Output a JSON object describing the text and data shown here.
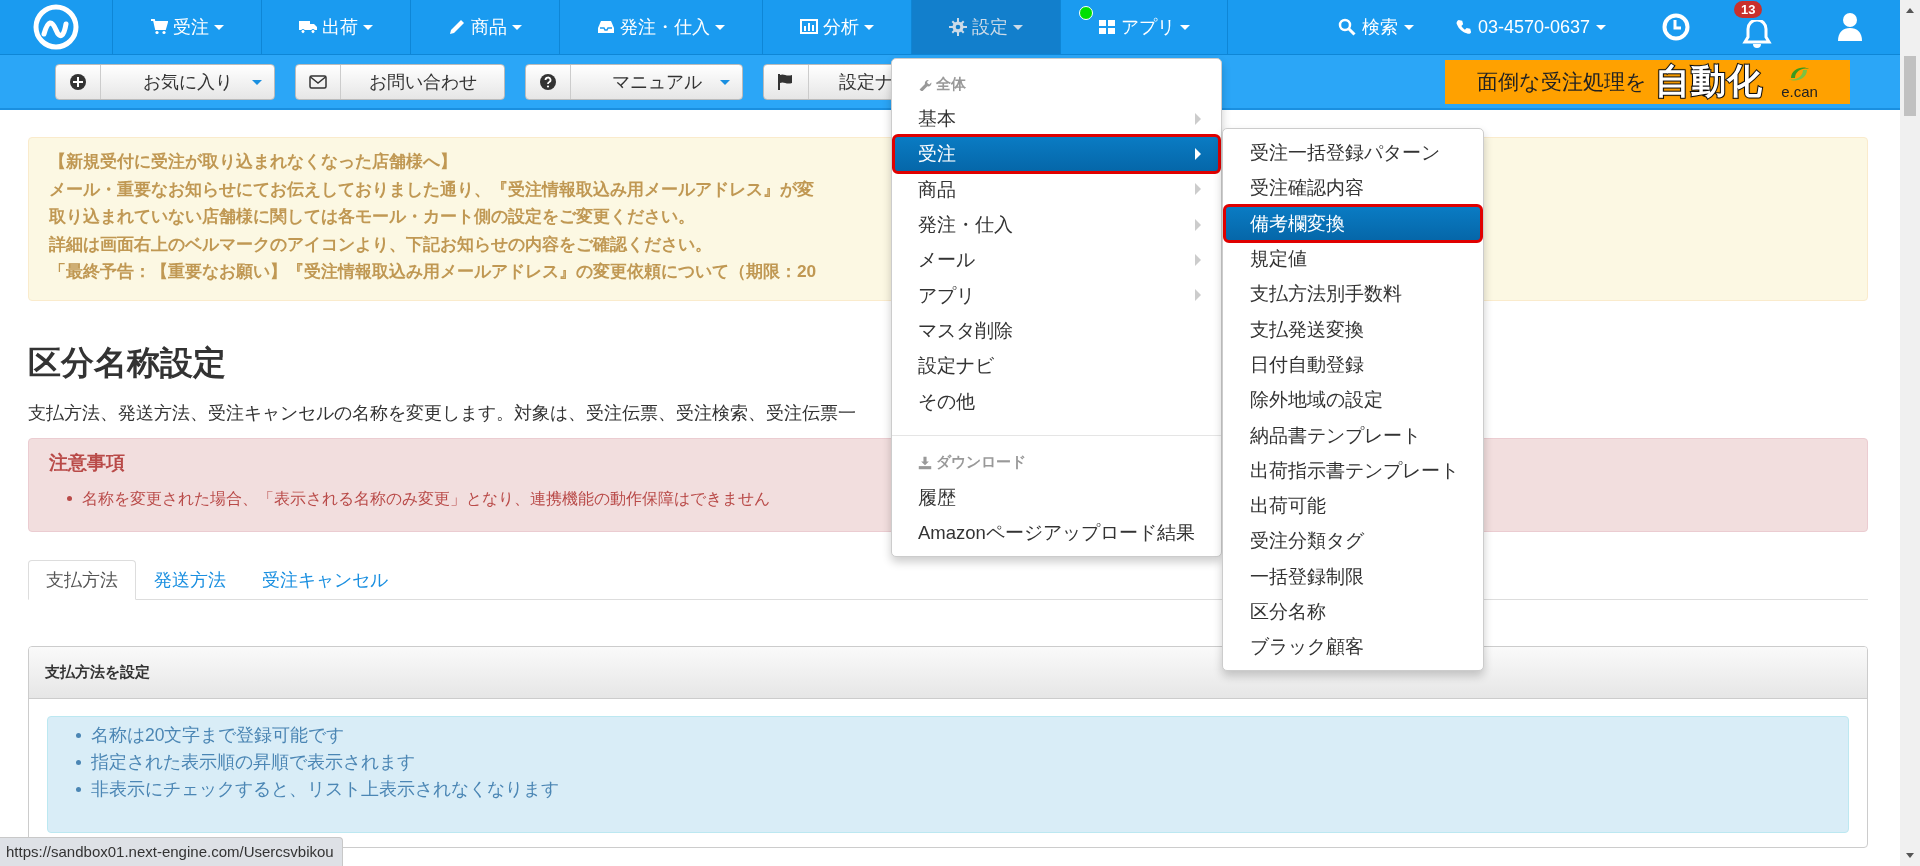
{
  "navbar": {
    "items": [
      {
        "label": "受注",
        "selected": false,
        "indicator": false
      },
      {
        "label": "出荷",
        "selected": false,
        "indicator": false
      },
      {
        "label": "商品",
        "selected": false,
        "indicator": false
      },
      {
        "label": "発注・仕入",
        "selected": false,
        "indicator": false
      },
      {
        "label": "分析",
        "selected": false,
        "indicator": false
      },
      {
        "label": "設定",
        "selected": true,
        "indicator": false
      },
      {
        "label": "アプリ",
        "selected": false,
        "indicator": true
      }
    ],
    "search": "検索",
    "phone": "03-4570-0637",
    "notification_count": "13"
  },
  "toolbar": {
    "buttons": [
      {
        "label": "お気に入り",
        "dropdown": true
      },
      {
        "label": "お問い合わせ",
        "dropdown": false
      },
      {
        "label": "マニュアル",
        "dropdown": true
      },
      {
        "label": "設定ナ",
        "dropdown": false
      }
    ],
    "banner": {
      "text": "面倒な受注処理を",
      "highlight": "自動化",
      "logo": "e.can"
    }
  },
  "notice": {
    "lines": [
      "【新規受付に受注が取り込まれなくなった店舗様へ】",
      "メール・重要なお知らせにてお伝えしておりました通り、『受注情報取込み用メールアドレス』が変",
      "取り込まれていない店舗様に関しては各モール・カート側の設定をご変更ください。",
      "詳細は画面右上のベルマークのアイコンより、下記お知らせの内容をご確認ください。",
      "「最終予告：【重要なお願い】『受注情報取込み用メールアドレス』の変更依頼について（期限：20"
    ]
  },
  "heading": "区分名称設定",
  "description": "支払方法、発送方法、受注キャンセルの名称を変更します。対象は、受注伝票、受注検索、受注伝票一",
  "alert": {
    "title": "注意事項",
    "items": [
      "名称を変更された場合、「表示される名称のみ変更」となり、連携機能の動作保障はできません"
    ]
  },
  "tabs": [
    {
      "label": "支払方法",
      "selected": true
    },
    {
      "label": "発送方法",
      "selected": false
    },
    {
      "label": "受注キャンセル",
      "selected": false
    }
  ],
  "panel": {
    "title": "支払方法を設定",
    "info": [
      "名称は20文字まで登録可能です",
      "指定された表示順の昇順で表示されます",
      "非表示にチェックすると、リスト上表示されなくなります"
    ]
  },
  "status_url": "https://sandbox01.next-engine.com/Usercsvbikou",
  "menu": {
    "sections": [
      {
        "header": "全体",
        "items": [
          {
            "label": "基本",
            "submenu": true,
            "selected": false
          },
          {
            "label": "受注",
            "submenu": true,
            "selected": true
          },
          {
            "label": "商品",
            "submenu": true,
            "selected": false
          },
          {
            "label": "発注・仕入",
            "submenu": true,
            "selected": false
          },
          {
            "label": "メール",
            "submenu": true,
            "selected": false
          },
          {
            "label": "アプリ",
            "submenu": true,
            "selected": false
          },
          {
            "label": "マスタ削除",
            "submenu": false,
            "selected": false
          },
          {
            "label": "設定ナビ",
            "submenu": false,
            "selected": false
          },
          {
            "label": "その他",
            "submenu": false,
            "selected": false
          }
        ]
      },
      {
        "header": "ダウンロード",
        "items": [
          {
            "label": "履歴",
            "submenu": false,
            "selected": false
          },
          {
            "label": "Amazonページアップロード結果",
            "submenu": false,
            "selected": false
          }
        ]
      }
    ]
  },
  "submenu": {
    "items": [
      {
        "label": "受注一括登録パターン",
        "selected": false
      },
      {
        "label": "受注確認内容",
        "selected": false
      },
      {
        "label": "備考欄変換",
        "selected": true
      },
      {
        "label": "規定値",
        "selected": false
      },
      {
        "label": "支払方法別手数料",
        "selected": false
      },
      {
        "label": "支払発送変換",
        "selected": false
      },
      {
        "label": "日付自動登録",
        "selected": false
      },
      {
        "label": "除外地域の設定",
        "selected": false
      },
      {
        "label": "納品書テンプレート",
        "selected": false
      },
      {
        "label": "出荷指示書テンプレート",
        "selected": false
      },
      {
        "label": "出荷可能",
        "selected": false
      },
      {
        "label": "受注分類タグ",
        "selected": false
      },
      {
        "label": "一括登録制限",
        "selected": false
      },
      {
        "label": "区分名称",
        "selected": false
      },
      {
        "label": "ブラック顧客",
        "selected": false
      }
    ]
  }
}
